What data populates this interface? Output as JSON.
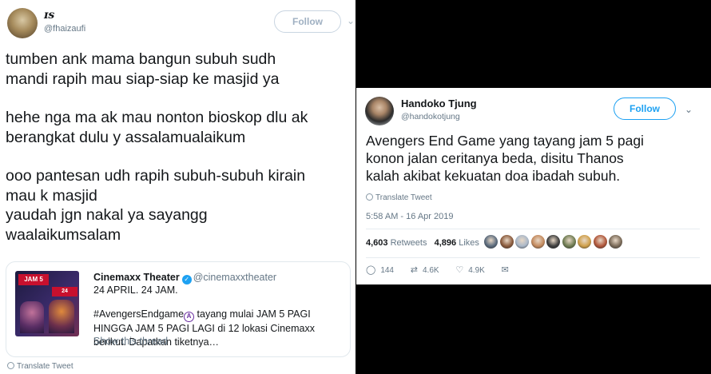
{
  "left_tweet": {
    "display_name": "ɪs",
    "handle": "@fhaizaufi",
    "follow_label": "Follow",
    "paragraphs": [
      [
        "tumben ank mama bangun subuh sudh",
        "mandi rapih mau siap-siap ke masjid ya"
      ],
      [
        "hehe nga ma ak mau nonton bioskop dlu ak",
        "berangkat dulu y assalamualaikum"
      ],
      [
        "ooo pantesan udh rapih subuh-subuh kirain",
        "mau k masjid",
        "yaudah jgn nakal ya sayangg",
        "waalaikumsalam"
      ]
    ],
    "quote": {
      "name": "Cinemaxx Theater",
      "handle": "@cinemaxxtheater",
      "line1": "24 APRIL. 24 JAM.",
      "text_before": "#AvengersEndgame",
      "text_after": " tayang mulai JAM 5 PAGI HINGGA JAM 5 PAGI LAGI di 12 lokasi Cinemaxx berikut. Dapatkan tiketnya…",
      "show_thread": "Show this thread",
      "poster_badge_1": "JAM 5",
      "poster_badge_2": "24"
    },
    "translate_label": "Translate Tweet"
  },
  "right_tweet": {
    "display_name": "Handoko Tjung",
    "handle": "@handokotjung",
    "follow_label": "Follow",
    "lines": [
      "Avengers End Game yang tayang jam 5 pagi",
      "konon jalan ceritanya beda, disitu Thanos",
      "kalah akibat kekuatan doa ibadah subuh."
    ],
    "translate_label": "Translate Tweet",
    "timestamp": "5:58 AM - 16 Apr 2019",
    "retweets_count": "4,603",
    "retweets_label": "Retweets",
    "likes_count": "4,896",
    "likes_label": "Likes",
    "likers": [
      {
        "color": "#5b6b7d"
      },
      {
        "color": "#8a5a3c"
      },
      {
        "color": "#aab8c9"
      },
      {
        "color": "#c48a5e"
      },
      {
        "color": "#3d3d3d"
      },
      {
        "color": "#6f7c52"
      },
      {
        "color": "#d0a04a"
      },
      {
        "color": "#b0563a"
      },
      {
        "color": "#7a6a58"
      }
    ],
    "actions": {
      "reply": "144",
      "retweet": "4.6K",
      "like": "4.9K"
    }
  },
  "colors": {
    "twitter_blue": "#1da1f2",
    "muted_text": "#657786",
    "background": "#000000"
  }
}
